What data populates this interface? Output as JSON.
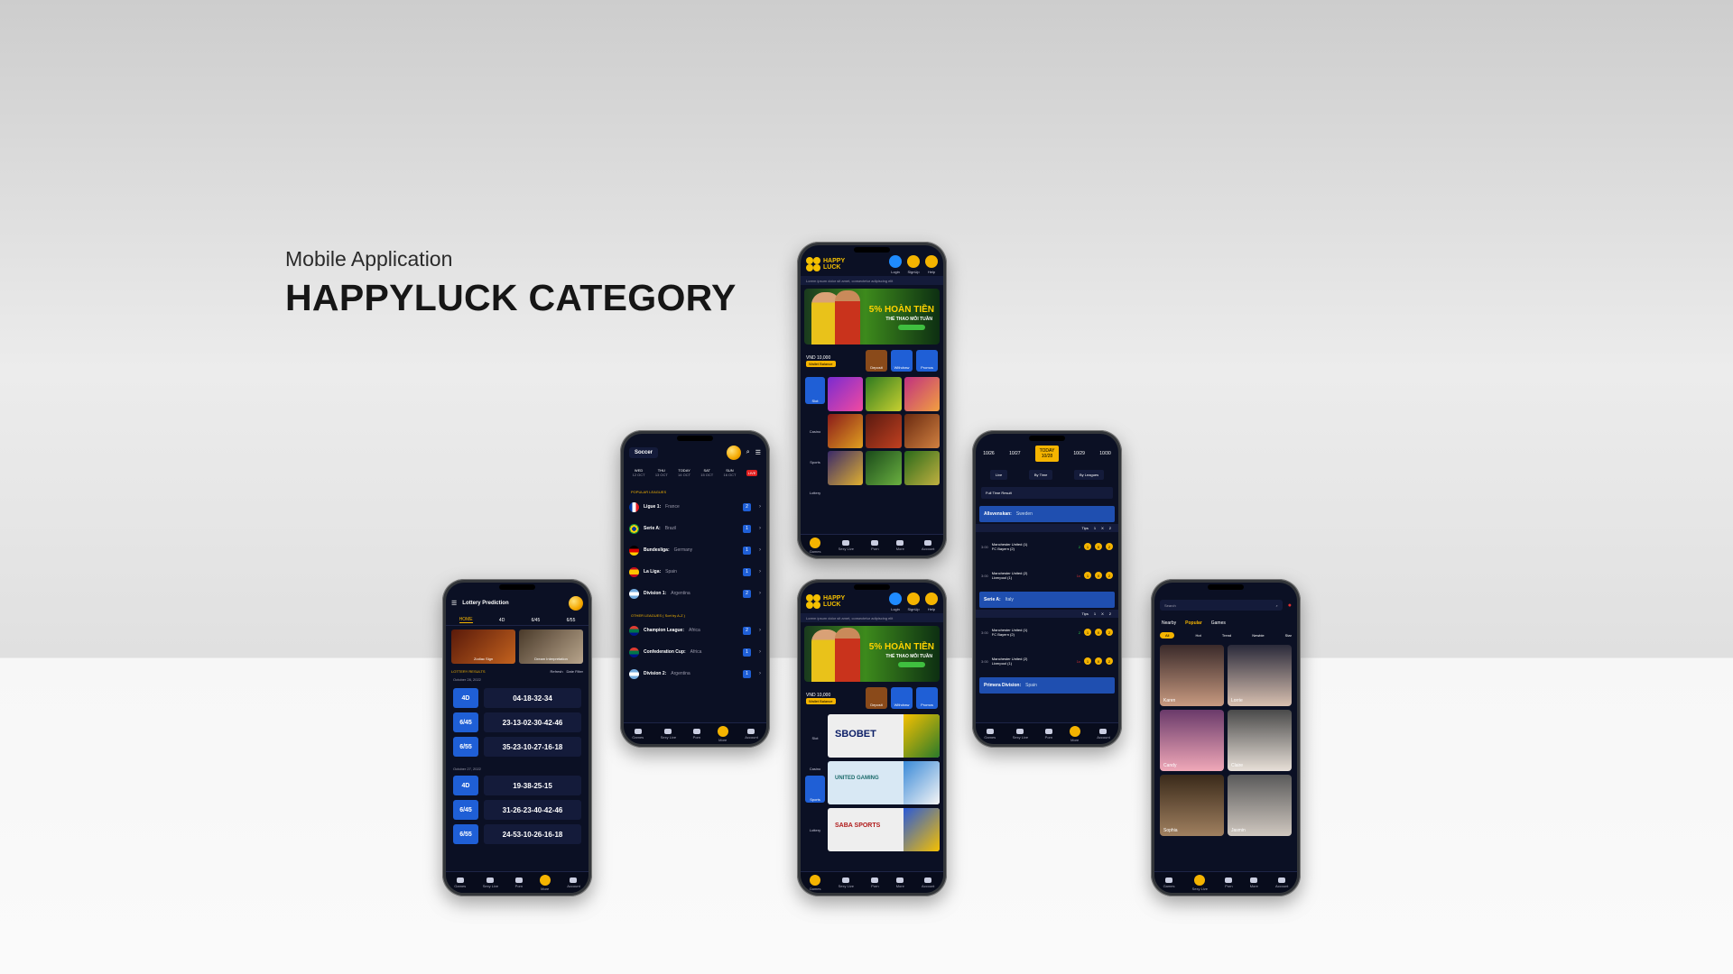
{
  "hero": {
    "subtitle": "Mobile Application",
    "title": "HAPPYLUCK CATEGORY"
  },
  "brand": {
    "line1": "HAPPY",
    "line2": "LUCK",
    "accent": "#f5b400",
    "blue": "#1f5fd6",
    "bg": "#0b1024"
  },
  "nav": [
    "Games",
    "Sexy Live",
    "Porn",
    "More",
    "Account"
  ],
  "home": {
    "actions": [
      "Login",
      "SignUp",
      "Help"
    ],
    "marquee": "Lorem ipsum dolor sit amet, consectetur adipiscing elit",
    "banner_title": "5% HOÀN TIỀN",
    "banner_sub": "THỂ THAO MỖI TUẦN",
    "balance": "VND 10,000",
    "wallet_label": "Wallet Balance",
    "wallet_actions": [
      "Deposit",
      "Withdraw",
      "Promos"
    ],
    "categories": [
      "Slot",
      "Casino",
      "Sports",
      "Lottery"
    ],
    "sports_brands": [
      "SBOBET",
      "UNITED GAMING",
      "SABA SPORTS"
    ]
  },
  "soccer": {
    "sport": "Soccer",
    "days": [
      {
        "d": "WED",
        "t": "12 OCT"
      },
      {
        "d": "THU",
        "t": "13 OCT"
      },
      {
        "d": "TODAY",
        "t": "14 OCT"
      },
      {
        "d": "SAT",
        "t": "15 OCT"
      },
      {
        "d": "SUN",
        "t": "16 OCT"
      }
    ],
    "live": "LIVE",
    "popular_title": "POPULAR LEAGUES",
    "popular": [
      {
        "name": "Ligue 1:",
        "country": "France",
        "count": "2"
      },
      {
        "name": "Serie A:",
        "country": "Brazil",
        "count": "1"
      },
      {
        "name": "Bundesliga:",
        "country": "Germany",
        "count": "1"
      },
      {
        "name": "La Liga:",
        "country": "Spain",
        "count": "1"
      },
      {
        "name": "Division 1:",
        "country": "Argentina",
        "count": "2"
      }
    ],
    "other_title": "OTHER LEAGUES ( Sort by A-Z )",
    "other": [
      {
        "name": "Champion League:",
        "country": "Africa",
        "count": "2"
      },
      {
        "name": "Confederation Cup:",
        "country": "Africa",
        "count": "1"
      },
      {
        "name": "Division 2:",
        "country": "Argentina",
        "count": "1"
      }
    ]
  },
  "lottery": {
    "title": "Lottery Prediction",
    "tabs": [
      "HOME",
      "4D",
      "6/45",
      "6/55"
    ],
    "cards": [
      "Zodiac Sign",
      "Dream Interpretation"
    ],
    "results_title": "LOTTERY RESULTS",
    "refresh": "Refresh",
    "filter": "Date Filter",
    "groups": [
      {
        "date": "October 28, 2022",
        "rows": [
          {
            "k": "4D",
            "v": "04-18-32-34"
          },
          {
            "k": "6/45",
            "v": "23-13-02-30-42-46"
          },
          {
            "k": "6/55",
            "v": "35-23-10-27-16-18"
          }
        ]
      },
      {
        "date": "October 27, 2022",
        "rows": [
          {
            "k": "4D",
            "v": "19-38-25-15"
          },
          {
            "k": "6/45",
            "v": "31-26-23-40-42-46"
          },
          {
            "k": "6/55",
            "v": "24-53-10-26-16-18"
          }
        ]
      }
    ]
  },
  "results": {
    "dates": [
      "10/26",
      "10/27",
      "TODAY 10/28",
      "10/29",
      "10/30"
    ],
    "filters": [
      "Live",
      "By Time",
      "By Leagues"
    ],
    "select": "Full Time Result",
    "tips_labels": [
      "Tips",
      "1",
      "X",
      "2"
    ],
    "leagues": [
      {
        "name": "Allsvenskan:",
        "country": "Sweden",
        "matches": [
          {
            "time": "3:00",
            "home": "Manchester United",
            "hs": "(1)",
            "away": "FC Bayern",
            "as": "(2)",
            "tip": "2"
          },
          {
            "time": "3:00",
            "home": "Manchester United",
            "hs": "(2)",
            "away": "Liverpool",
            "as": "(1)",
            "tip": "1x"
          }
        ]
      },
      {
        "name": "Serie A:",
        "country": "Italy",
        "matches": [
          {
            "time": "3:00",
            "home": "Manchester United",
            "hs": "(1)",
            "away": "FC Bayern",
            "as": "(2)",
            "tip": "2"
          },
          {
            "time": "3:00",
            "home": "Manchester United",
            "hs": "(2)",
            "away": "Liverpool",
            "as": "(1)",
            "tip": "1x"
          }
        ]
      },
      {
        "name": "Primera Division:",
        "country": "Spain",
        "matches": []
      }
    ]
  },
  "social": {
    "search": "Search",
    "tabs": [
      "Nearby",
      "Popular",
      "Games"
    ],
    "chips": [
      "All",
      "Hot",
      "Trend",
      "Newbie",
      "Star"
    ],
    "people": [
      "Karen",
      "Lorrie",
      "Candy",
      "Claire",
      "Sophia",
      "Jasmin"
    ]
  }
}
